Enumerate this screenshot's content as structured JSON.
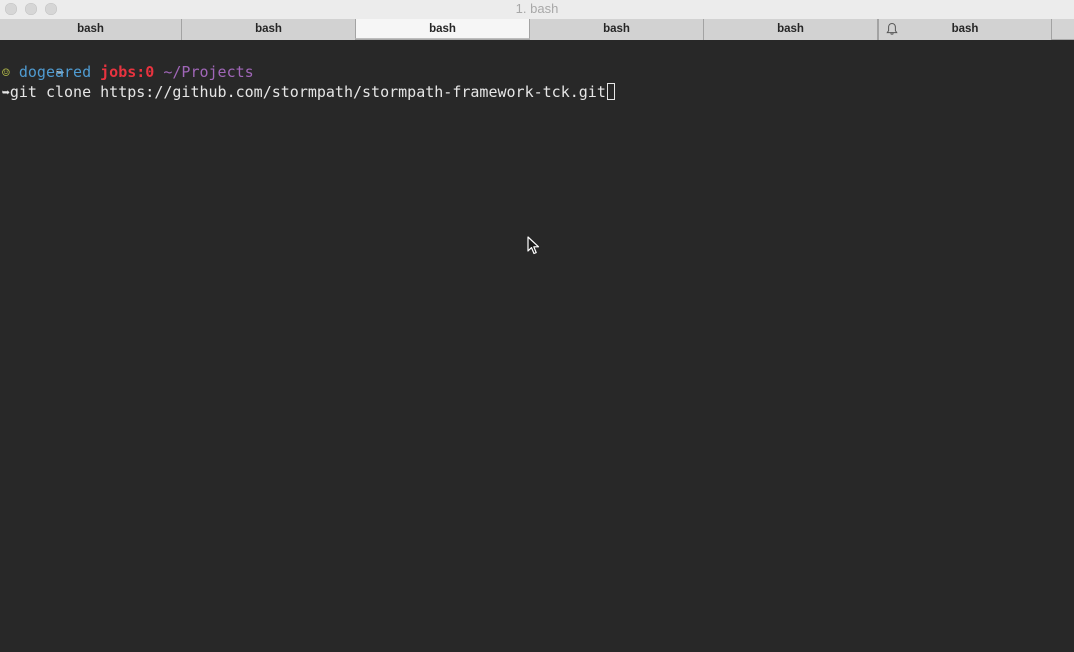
{
  "window": {
    "title": "1. bash"
  },
  "tabs": [
    {
      "label": "bash",
      "active": false,
      "bell": false
    },
    {
      "label": "bash",
      "active": false,
      "bell": false
    },
    {
      "label": "bash",
      "active": true,
      "bell": false
    },
    {
      "label": "bash",
      "active": false,
      "bell": false
    },
    {
      "label": "bash",
      "active": false,
      "bell": false
    },
    {
      "label": "bash",
      "active": false,
      "bell": true
    }
  ],
  "terminal": {
    "line1": {
      "arrow": "➥"
    },
    "line2": {
      "smiley": "☺",
      "host": "dogeared",
      "jobs": "jobs:0",
      "path": "~/Projects"
    },
    "line3": {
      "arrow": "➥",
      "command": "git clone https://github.com/stormpath/stormpath-framework-tck.git"
    }
  },
  "colors": {
    "background": "#282828",
    "host": "#4f9bd1",
    "jobs": "#e8333f",
    "path": "#a066b8",
    "smiley": "#b8c04a"
  },
  "icons": {
    "bell": "bell-icon",
    "pointer": "mouse-pointer-icon"
  }
}
